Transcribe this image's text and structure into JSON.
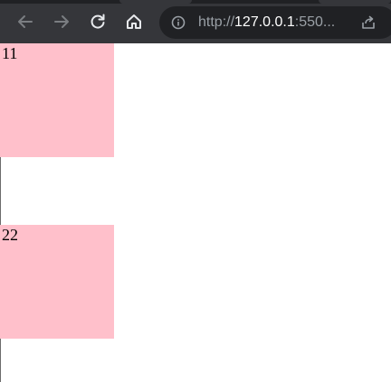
{
  "browser": {
    "url_scheme": "http://",
    "url_host": "127.0.0.1",
    "url_rest": ":550...",
    "chrome_color": "#35363a",
    "omnibox_color": "#202124"
  },
  "page": {
    "boxes": [
      {
        "label": "11",
        "color": "#ffc0cb"
      },
      {
        "label": "22",
        "color": "#ffc0cb"
      }
    ]
  },
  "icons": {
    "back": "arrow-left-icon",
    "forward": "arrow-right-icon",
    "reload": "reload-icon",
    "home": "home-icon",
    "info": "info-icon",
    "share": "share-icon"
  }
}
